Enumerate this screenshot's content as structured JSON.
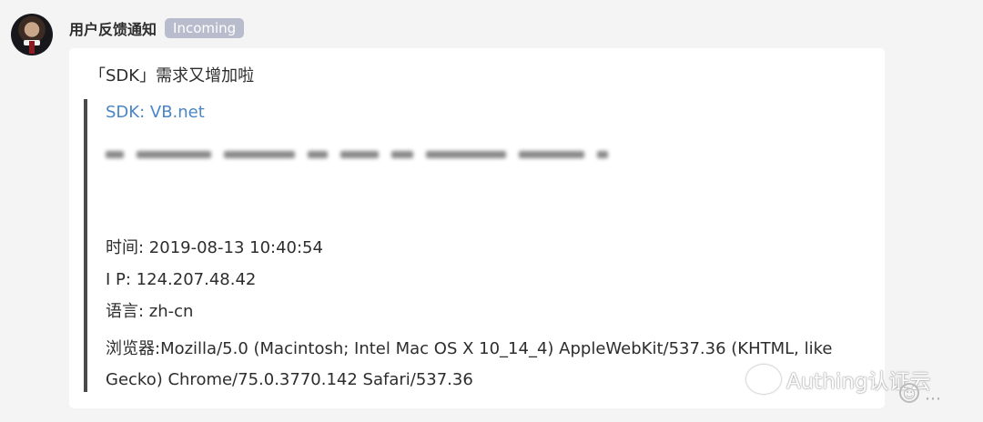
{
  "message": {
    "sender": "用户反馈通知",
    "badge": "Incoming",
    "intro": "「SDK」需求又增加啦",
    "sdk_line": "SDK: VB.net",
    "time": "时间: 2019-08-13 10:40:54",
    "ip": "I P: 124.207.48.42",
    "language": "语言: zh-cn",
    "browser": "浏览器:Mozilla/5.0 (Macintosh; Intel Mac OS X 10_14_4) AppleWebKit/537.36 (KHTML, like Gecko) Chrome/75.0.3770.142 Safari/537.36"
  },
  "watermark": {
    "text": "Authing认证云"
  },
  "icons": {
    "emoji": "smiley-icon",
    "more": "more-icon"
  },
  "colors": {
    "link": "#4a86c6",
    "badge": "#b9bccd",
    "quote_bar": "#4a4a4a"
  }
}
